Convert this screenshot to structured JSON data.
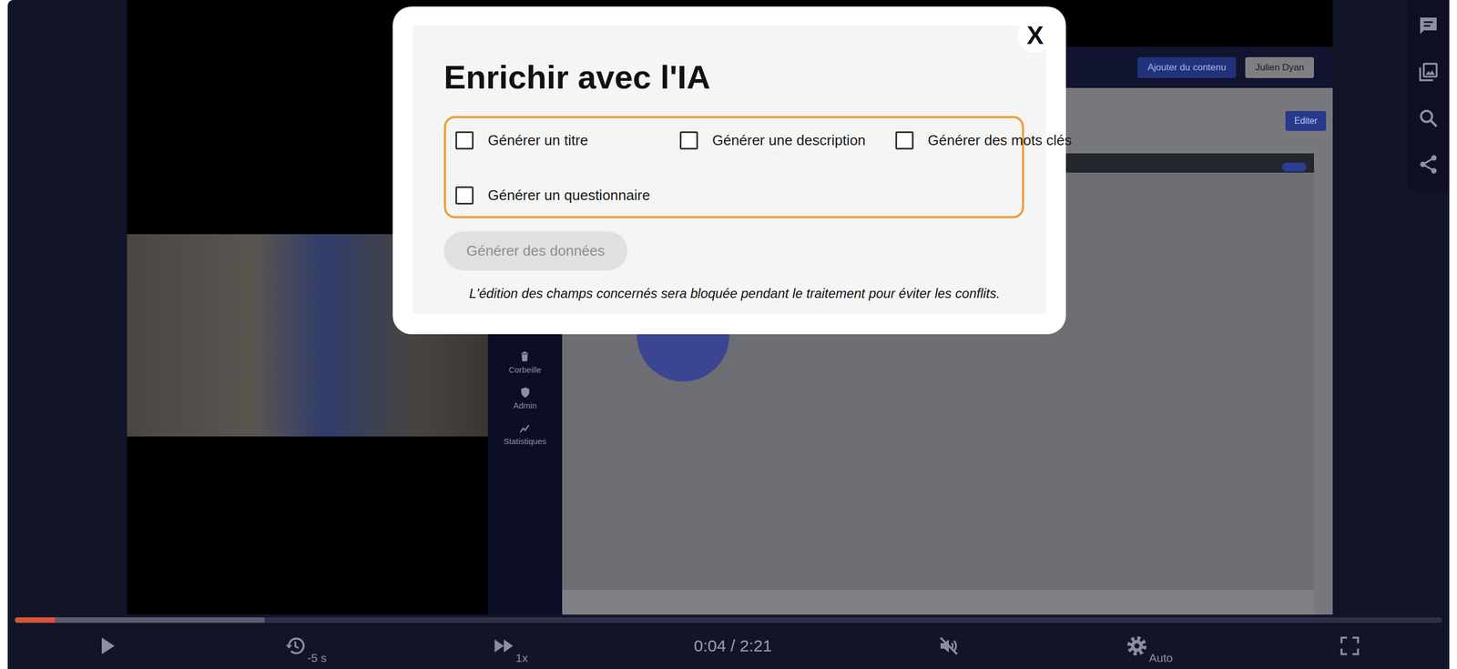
{
  "modal": {
    "title": "Enrichir avec l'IA",
    "close": "X",
    "options": [
      {
        "label": "Générer un titre",
        "checked": false
      },
      {
        "label": "Générer une description",
        "checked": false
      },
      {
        "label": "Générer des mots clés",
        "checked": false
      },
      {
        "label": "Générer un questionnaire",
        "checked": false
      }
    ],
    "submit": {
      "label": "Générer des données",
      "disabled": true
    },
    "note": "L'édition des champs concernés sera bloquée pendant le traitement pour éviter les conflits."
  },
  "side_actions": [
    {
      "kind": "chat"
    },
    {
      "kind": "gallery"
    },
    {
      "kind": "search"
    },
    {
      "kind": "share"
    }
  ],
  "video_frame": {
    "app_header": {
      "buttons": [
        "Ajouter du contenu",
        "Julien Dyan"
      ]
    },
    "nav": [
      {
        "kind": "trash",
        "label": "Corbeille"
      },
      {
        "kind": "admin",
        "label": "Admin"
      },
      {
        "kind": "stats",
        "label": "Statistiques"
      }
    ],
    "edit_button": "Editer"
  },
  "player": {
    "progress": {
      "played": 0.028,
      "buffered": 0.175
    },
    "controls": [
      {
        "kind": "play"
      },
      {
        "kind": "rewind",
        "label": "-5 s"
      },
      {
        "kind": "speed",
        "label": "1x"
      },
      {
        "kind": "time",
        "label": "0:04 / 2:21"
      },
      {
        "kind": "mute"
      },
      {
        "kind": "settings",
        "label": "Auto"
      },
      {
        "kind": "fullscreen"
      }
    ]
  }
}
